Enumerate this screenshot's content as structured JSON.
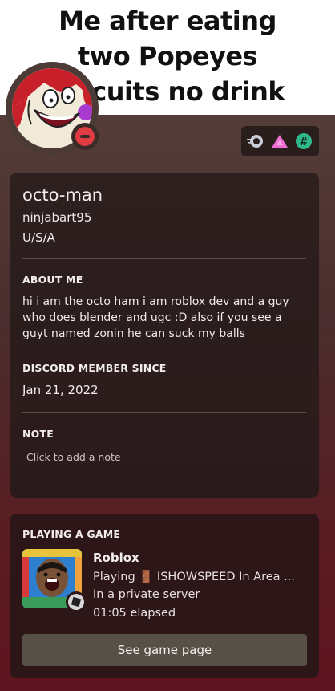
{
  "banner": {
    "text": "Me after eating two Popeyes biscuits no drink"
  },
  "profile": {
    "display_name": "octo-man",
    "username": "ninjabart95",
    "pronouns": "U/S/A",
    "status": "do-not-disturb"
  },
  "badges": [
    "nitro-badge-icon",
    "hypesquad-balance-icon",
    "hashtag-badge-icon"
  ],
  "about": {
    "header": "ABOUT ME",
    "text": "hi i am the octo ham i am roblox dev and a guy who does blender and ugc :D also if you see a guyt named zonin he can suck my balls"
  },
  "member_since": {
    "header": "DISCORD MEMBER SINCE",
    "date": "Jan 21, 2022"
  },
  "note": {
    "header": "NOTE",
    "placeholder": "Click to add a note"
  },
  "activity": {
    "header": "PLAYING A GAME",
    "game": "Roblox",
    "details": "Playing 🚪 ISHOWSPEED In Area ...",
    "state": "In a private server",
    "elapsed": "01:05 elapsed",
    "button_label": "See game page"
  },
  "colors": {
    "status_dnd": "#e03c43",
    "button_bg": "#575046",
    "card_bg": "#2c1c1c"
  }
}
